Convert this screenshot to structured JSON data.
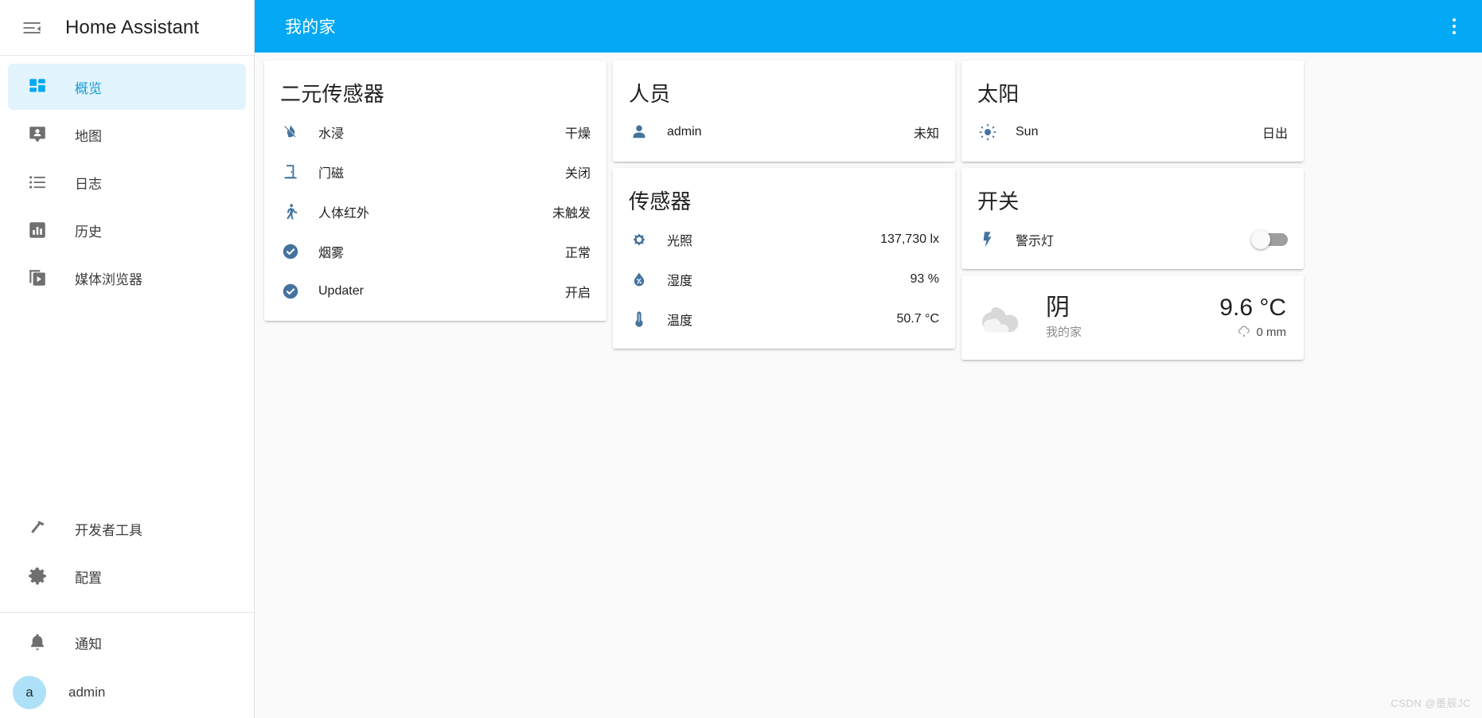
{
  "sidebar": {
    "title": "Home Assistant",
    "menu_icon": "menu-open-icon",
    "items": [
      {
        "label": "概览",
        "icon": "view-dashboard-icon",
        "active": true
      },
      {
        "label": "地图",
        "icon": "map-marker-account-icon",
        "active": false
      },
      {
        "label": "日志",
        "icon": "format-list-bulleted-icon",
        "active": false
      },
      {
        "label": "历史",
        "icon": "chart-box-icon",
        "active": false
      },
      {
        "label": "媒体浏览器",
        "icon": "play-box-multiple-icon",
        "active": false
      }
    ],
    "bottom_items": [
      {
        "label": "开发者工具",
        "icon": "hammer-wrench-icon"
      },
      {
        "label": "配置",
        "icon": "cog-icon"
      }
    ],
    "notifications": {
      "label": "通知",
      "icon": "bell-icon"
    },
    "user": {
      "label": "admin",
      "initial": "a",
      "avatar_color": "#aee1f7"
    }
  },
  "topbar": {
    "title": "我的家",
    "overflow_icon": "dots-vertical-icon",
    "background": "#03a9f4"
  },
  "cards": {
    "binary_sensor": {
      "title": "二元传感器",
      "rows": [
        {
          "name": "水浸",
          "value": "干燥",
          "icon": "water-off-icon"
        },
        {
          "name": "门磁",
          "value": "关闭",
          "icon": "door-closed-icon"
        },
        {
          "name": "人体红外",
          "value": "未触发",
          "icon": "walk-icon"
        },
        {
          "name": "烟雾",
          "value": "正常",
          "icon": "check-circle-icon"
        },
        {
          "name": "Updater",
          "value": "开启",
          "icon": "check-circle-icon"
        }
      ]
    },
    "person": {
      "title": "人员",
      "rows": [
        {
          "name": "admin",
          "value": "未知",
          "icon": "account-icon"
        }
      ]
    },
    "sensor": {
      "title": "传感器",
      "rows": [
        {
          "name": "光照",
          "value": "137,730 lx",
          "icon": "brightness-icon"
        },
        {
          "name": "湿度",
          "value": "93 %",
          "icon": "water-percent-icon"
        },
        {
          "name": "温度",
          "value": "50.7 °C",
          "icon": "thermometer-icon"
        }
      ]
    },
    "sun": {
      "title": "太阳",
      "rows": [
        {
          "name": "Sun",
          "value": "日出",
          "icon": "weather-sunny-icon"
        }
      ]
    },
    "switch": {
      "title": "开关",
      "rows": [
        {
          "name": "警示灯",
          "icon": "flash-icon",
          "toggle_on": false
        }
      ]
    },
    "weather": {
      "condition": "阴",
      "location": "我的家",
      "temperature": "9.6 °C",
      "precipitation": "0 mm",
      "condition_icon": "weather-cloudy-icon",
      "precipitation_icon": "weather-rainy-icon"
    }
  },
  "watermark": "CSDN @墨辰JC",
  "colors": {
    "accent": "#03a9f4",
    "icon_blue": "#44739e",
    "sidebar_active_bg": "#e2f4fd"
  }
}
